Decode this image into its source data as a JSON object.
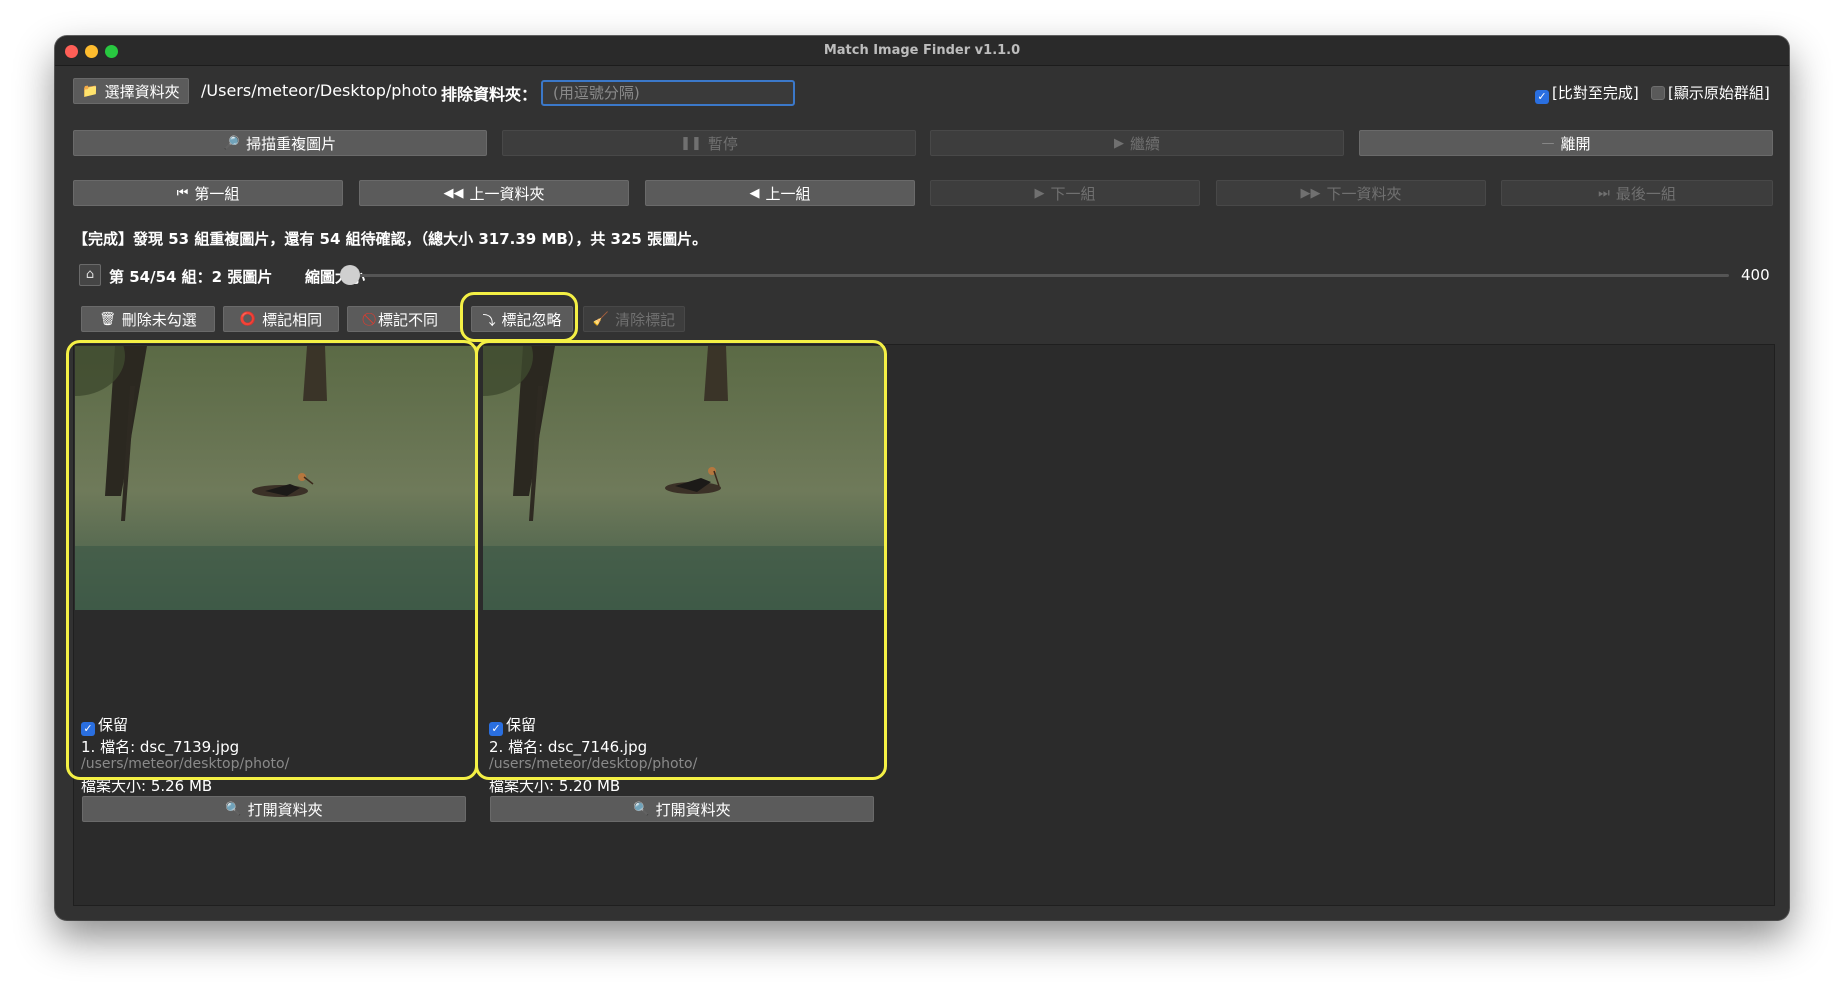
{
  "window": {
    "title": "Match Image Finder v1.1.0"
  },
  "toolbar": {
    "choose_folder_label": "選擇資料夾",
    "folder_path": "/Users/meteor/Desktop/photo",
    "exclude_label": "排除資料夾：",
    "exclude_placeholder": "(用逗號分隔)",
    "compare_until_done_label": "[比對至完成]",
    "compare_until_done_checked": true,
    "show_original_groups_label": "[顯示原始群組]",
    "show_original_groups_checked": false
  },
  "actions": {
    "scan_label": "掃描重複圖片",
    "pause_label": "暫停",
    "continue_label": "繼續",
    "leave_label": "離開"
  },
  "navigation": {
    "first_group": "第一組",
    "prev_folder": "上一資料夾",
    "prev_group": "上一組",
    "next_group": "下一組",
    "next_folder": "下一資料夾",
    "last_group": "最後一組"
  },
  "status": {
    "message": "【完成】發現 53 組重複圖片，還有 54 組待確認，（總大小 317.39 MB），共 325 張圖片。"
  },
  "group_info": {
    "label": "第 54/54 組：2 張圖片",
    "thumb_size_label": "縮圖大小",
    "thumb_size_value": "400"
  },
  "mark_actions": {
    "delete_unchecked": "刪除未勾選",
    "mark_same": "標記相同",
    "mark_different": "標記不同",
    "mark_ignore": "標記忽略",
    "clear_marks": "清除標記"
  },
  "images": [
    {
      "keep_label": "保留",
      "keep_checked": true,
      "name_line": "1. 檔名: dsc_7139.jpg",
      "path": "/users/meteor/desktop/photo/",
      "size_line": "檔案大小: 5.26 MB",
      "open_folder_label": "打開資料夾"
    },
    {
      "keep_label": "保留",
      "keep_checked": true,
      "name_line": "2. 檔名: dsc_7146.jpg",
      "path": "/users/meteor/desktop/photo/",
      "size_line": "檔案大小: 5.20 MB",
      "open_folder_label": "打開資料夾"
    }
  ],
  "colors": {
    "window_bg": "#323232",
    "button_bg": "#5b5b5b",
    "highlight": "#f4f045",
    "checkbox_accent": "#2a6fe0",
    "input_focus": "#3b78c9"
  }
}
